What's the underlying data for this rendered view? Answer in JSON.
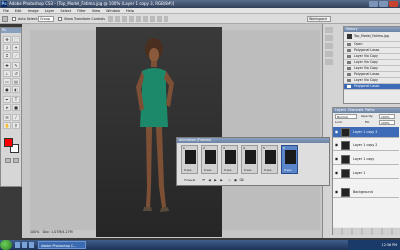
{
  "app": {
    "title": "Adobe Photoshop CS3 - [Top_Model_Fatima.jpg @ 100% (Layer 1 copy 3, RGB/8#)]",
    "logo": "Ps"
  },
  "menu": [
    "File",
    "Edit",
    "Image",
    "Layer",
    "Select",
    "Filter",
    "View",
    "Window",
    "Help"
  ],
  "options_bar": {
    "auto_select_label": "Auto Select:",
    "auto_select_value": "Group",
    "show_transform_label": "Show Transform Controls",
    "workspace_label": "Workspace"
  },
  "tools": [
    "move-tool",
    "marquee-tool",
    "lasso-tool",
    "magic-wand-tool",
    "crop-tool",
    "slice-tool",
    "healing-tool",
    "brush-tool",
    "stamp-tool",
    "history-brush-tool",
    "eraser-tool",
    "gradient-tool",
    "blur-tool",
    "dodge-tool",
    "pen-tool",
    "type-tool",
    "path-select-tool",
    "shape-tool",
    "notes-tool",
    "eyedropper-tool",
    "hand-tool",
    "zoom-tool"
  ],
  "colors": {
    "foreground": "#ff0000",
    "background": "#ffffff",
    "accent": "#3d6bb8",
    "dress": "#1c8a6a"
  },
  "history": {
    "panel_title": "History",
    "snapshot": "Top_Model_Fatima.jpg",
    "items": [
      "Open",
      "Polygonal Lasso",
      "Layer Via Copy",
      "Layer Via Copy",
      "Layer Via Copy",
      "Polygonal Lasso",
      "Layer Via Copy",
      "Polygonal Lasso"
    ]
  },
  "layers": {
    "tabs": [
      "Layers",
      "Channels",
      "Paths"
    ],
    "blend_mode": "Normal",
    "opacity_label": "Opacity:",
    "opacity_value": "100%",
    "lock_label": "Lock:",
    "fill_label": "Fill:",
    "fill_value": "100%",
    "rows": [
      {
        "name": "Layer 1 copy 3",
        "selected": true
      },
      {
        "name": "Layer 1 copy 2",
        "selected": false
      },
      {
        "name": "Layer 1 copy",
        "selected": false
      },
      {
        "name": "Layer 1",
        "selected": false
      },
      {
        "name": "Background",
        "selected": false
      }
    ]
  },
  "animation": {
    "panel_title": "Animation (Frames)",
    "frames": [
      {
        "num": "1",
        "time": "0 sec."
      },
      {
        "num": "2",
        "time": "0 sec."
      },
      {
        "num": "3",
        "time": "0 sec."
      },
      {
        "num": "4",
        "time": "0 sec."
      },
      {
        "num": "5",
        "time": "0 sec."
      },
      {
        "num": "6",
        "time": "0 sec."
      }
    ],
    "loop": "Forever"
  },
  "status": {
    "zoom": "100%",
    "doc_info": "Doc: 1.07M/4.27M"
  },
  "taskbar": {
    "task_label": "Adobe Photoshop C...",
    "clock": "12:36 PM"
  }
}
